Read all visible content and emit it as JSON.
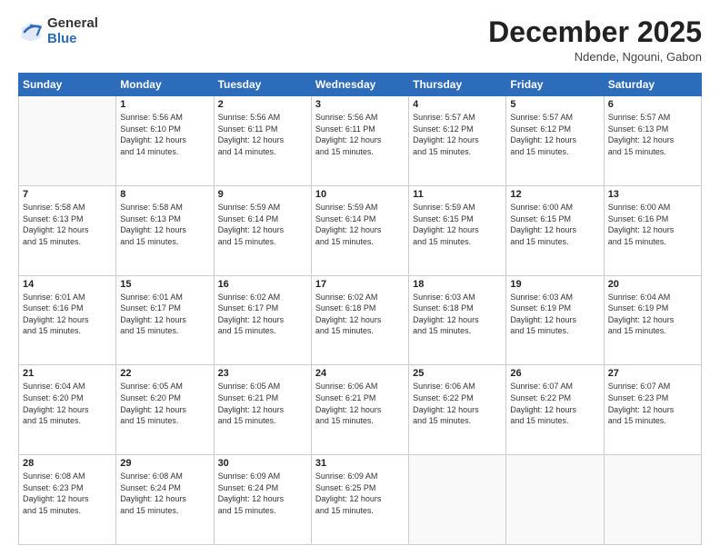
{
  "logo": {
    "general": "General",
    "blue": "Blue"
  },
  "header": {
    "month": "December 2025",
    "location": "Ndende, Ngouni, Gabon"
  },
  "days_of_week": [
    "Sunday",
    "Monday",
    "Tuesday",
    "Wednesday",
    "Thursday",
    "Friday",
    "Saturday"
  ],
  "weeks": [
    [
      {
        "day": "",
        "empty": true
      },
      {
        "day": "1",
        "sunrise": "5:56 AM",
        "sunset": "6:10 PM",
        "daylight": "12 hours and 14 minutes."
      },
      {
        "day": "2",
        "sunrise": "5:56 AM",
        "sunset": "6:11 PM",
        "daylight": "12 hours and 14 minutes."
      },
      {
        "day": "3",
        "sunrise": "5:56 AM",
        "sunset": "6:11 PM",
        "daylight": "12 hours and 15 minutes."
      },
      {
        "day": "4",
        "sunrise": "5:57 AM",
        "sunset": "6:12 PM",
        "daylight": "12 hours and 15 minutes."
      },
      {
        "day": "5",
        "sunrise": "5:57 AM",
        "sunset": "6:12 PM",
        "daylight": "12 hours and 15 minutes."
      },
      {
        "day": "6",
        "sunrise": "5:57 AM",
        "sunset": "6:13 PM",
        "daylight": "12 hours and 15 minutes."
      }
    ],
    [
      {
        "day": "7",
        "sunrise": "5:58 AM",
        "sunset": "6:13 PM",
        "daylight": "12 hours and 15 minutes."
      },
      {
        "day": "8",
        "sunrise": "5:58 AM",
        "sunset": "6:13 PM",
        "daylight": "12 hours and 15 minutes."
      },
      {
        "day": "9",
        "sunrise": "5:59 AM",
        "sunset": "6:14 PM",
        "daylight": "12 hours and 15 minutes."
      },
      {
        "day": "10",
        "sunrise": "5:59 AM",
        "sunset": "6:14 PM",
        "daylight": "12 hours and 15 minutes."
      },
      {
        "day": "11",
        "sunrise": "5:59 AM",
        "sunset": "6:15 PM",
        "daylight": "12 hours and 15 minutes."
      },
      {
        "day": "12",
        "sunrise": "6:00 AM",
        "sunset": "6:15 PM",
        "daylight": "12 hours and 15 minutes."
      },
      {
        "day": "13",
        "sunrise": "6:00 AM",
        "sunset": "6:16 PM",
        "daylight": "12 hours and 15 minutes."
      }
    ],
    [
      {
        "day": "14",
        "sunrise": "6:01 AM",
        "sunset": "6:16 PM",
        "daylight": "12 hours and 15 minutes."
      },
      {
        "day": "15",
        "sunrise": "6:01 AM",
        "sunset": "6:17 PM",
        "daylight": "12 hours and 15 minutes."
      },
      {
        "day": "16",
        "sunrise": "6:02 AM",
        "sunset": "6:17 PM",
        "daylight": "12 hours and 15 minutes."
      },
      {
        "day": "17",
        "sunrise": "6:02 AM",
        "sunset": "6:18 PM",
        "daylight": "12 hours and 15 minutes."
      },
      {
        "day": "18",
        "sunrise": "6:03 AM",
        "sunset": "6:18 PM",
        "daylight": "12 hours and 15 minutes."
      },
      {
        "day": "19",
        "sunrise": "6:03 AM",
        "sunset": "6:19 PM",
        "daylight": "12 hours and 15 minutes."
      },
      {
        "day": "20",
        "sunrise": "6:04 AM",
        "sunset": "6:19 PM",
        "daylight": "12 hours and 15 minutes."
      }
    ],
    [
      {
        "day": "21",
        "sunrise": "6:04 AM",
        "sunset": "6:20 PM",
        "daylight": "12 hours and 15 minutes."
      },
      {
        "day": "22",
        "sunrise": "6:05 AM",
        "sunset": "6:20 PM",
        "daylight": "12 hours and 15 minutes."
      },
      {
        "day": "23",
        "sunrise": "6:05 AM",
        "sunset": "6:21 PM",
        "daylight": "12 hours and 15 minutes."
      },
      {
        "day": "24",
        "sunrise": "6:06 AM",
        "sunset": "6:21 PM",
        "daylight": "12 hours and 15 minutes."
      },
      {
        "day": "25",
        "sunrise": "6:06 AM",
        "sunset": "6:22 PM",
        "daylight": "12 hours and 15 minutes."
      },
      {
        "day": "26",
        "sunrise": "6:07 AM",
        "sunset": "6:22 PM",
        "daylight": "12 hours and 15 minutes."
      },
      {
        "day": "27",
        "sunrise": "6:07 AM",
        "sunset": "6:23 PM",
        "daylight": "12 hours and 15 minutes."
      }
    ],
    [
      {
        "day": "28",
        "sunrise": "6:08 AM",
        "sunset": "6:23 PM",
        "daylight": "12 hours and 15 minutes."
      },
      {
        "day": "29",
        "sunrise": "6:08 AM",
        "sunset": "6:24 PM",
        "daylight": "12 hours and 15 minutes."
      },
      {
        "day": "30",
        "sunrise": "6:09 AM",
        "sunset": "6:24 PM",
        "daylight": "12 hours and 15 minutes."
      },
      {
        "day": "31",
        "sunrise": "6:09 AM",
        "sunset": "6:25 PM",
        "daylight": "12 hours and 15 minutes."
      },
      {
        "day": "",
        "empty": true
      },
      {
        "day": "",
        "empty": true
      },
      {
        "day": "",
        "empty": true
      }
    ]
  ],
  "labels": {
    "sunrise": "Sunrise:",
    "sunset": "Sunset:",
    "daylight": "Daylight:"
  }
}
